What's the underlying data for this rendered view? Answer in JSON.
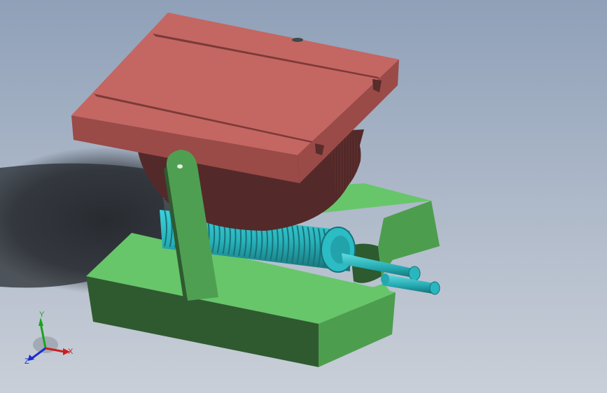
{
  "scene": {
    "colors": {
      "table_top": "#c46662",
      "table_side": "#9a4a47",
      "table_dark": "#7a3a38",
      "cradle": "#54292a",
      "base_top": "#67c66a",
      "base_side": "#4c9e4e",
      "base_front": "#2f5a30",
      "worm": "#29b3bb",
      "worm_dark": "#1d8087",
      "shadow": "#2a2e33"
    }
  },
  "triad": {
    "x_label": "X",
    "y_label": "Y",
    "z_label": "Z",
    "x_color": "#cc1f1f",
    "y_color": "#19a51c",
    "z_color": "#1c2bd0"
  }
}
